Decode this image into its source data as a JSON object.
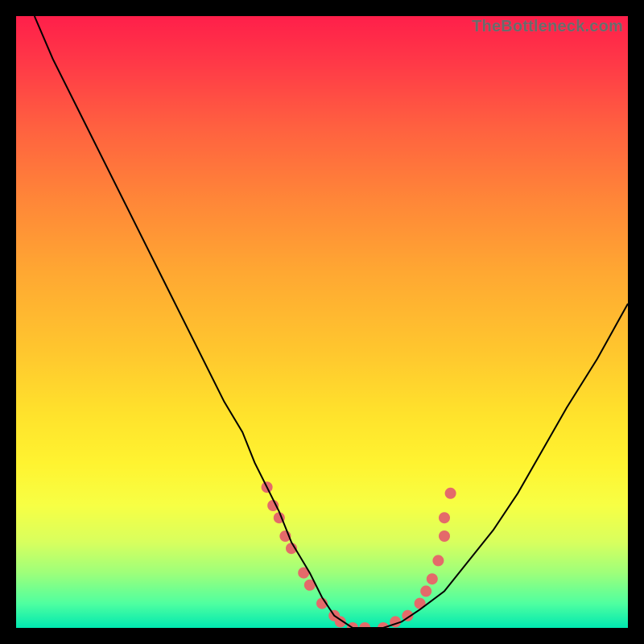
{
  "watermark": "TheBottleneck.com",
  "chart_data": {
    "type": "line",
    "title": "",
    "xlabel": "",
    "ylabel": "",
    "xlim": [
      0,
      100
    ],
    "ylim": [
      0,
      100
    ],
    "grid": false,
    "legend": false,
    "series": [
      {
        "name": "curve",
        "x": [
          3,
          6,
          10,
          14,
          18,
          22,
          25,
          28,
          31,
          34,
          37,
          39,
          41,
          43,
          45,
          48,
          50,
          52,
          55,
          58,
          60,
          63,
          66,
          70,
          74,
          78,
          82,
          86,
          90,
          95,
          100
        ],
        "y": [
          100,
          93,
          85,
          77,
          69,
          61,
          55,
          49,
          43,
          37,
          32,
          27,
          23,
          19,
          14,
          9,
          5,
          2,
          0,
          0,
          0,
          1,
          3,
          6,
          11,
          16,
          22,
          29,
          36,
          44,
          53
        ],
        "color": "#000000",
        "stroke_width": 2
      }
    ],
    "highlight_band": {
      "name": "confidence-dots",
      "color": "#e46a6a",
      "points": [
        {
          "x": 41,
          "y": 23
        },
        {
          "x": 42,
          "y": 20
        },
        {
          "x": 43,
          "y": 18
        },
        {
          "x": 44,
          "y": 15
        },
        {
          "x": 45,
          "y": 13
        },
        {
          "x": 47,
          "y": 9
        },
        {
          "x": 48,
          "y": 7
        },
        {
          "x": 50,
          "y": 4
        },
        {
          "x": 52,
          "y": 2
        },
        {
          "x": 53,
          "y": 1
        },
        {
          "x": 55,
          "y": 0
        },
        {
          "x": 57,
          "y": 0
        },
        {
          "x": 60,
          "y": 0
        },
        {
          "x": 62,
          "y": 1
        },
        {
          "x": 64,
          "y": 2
        },
        {
          "x": 66,
          "y": 4
        },
        {
          "x": 67,
          "y": 6
        },
        {
          "x": 68,
          "y": 8
        },
        {
          "x": 69,
          "y": 11
        },
        {
          "x": 70,
          "y": 15
        },
        {
          "x": 70,
          "y": 18
        },
        {
          "x": 71,
          "y": 22
        }
      ]
    }
  }
}
